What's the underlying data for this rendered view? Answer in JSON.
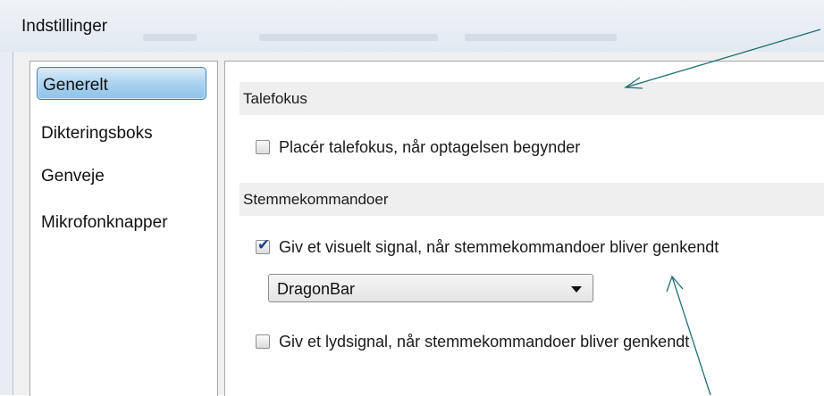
{
  "window": {
    "title": "Indstillinger"
  },
  "sidebar": {
    "items": [
      {
        "label": "Generelt",
        "selected": true
      },
      {
        "label": "Dikteringsboks"
      },
      {
        "label": "Genveje"
      },
      {
        "label": "Mikrofonknapper"
      }
    ]
  },
  "main": {
    "sections": [
      {
        "header": "Talefokus",
        "options": [
          {
            "label": "Placér talefokus, når optagelsen begynder",
            "checked": false
          }
        ]
      },
      {
        "header": "Stemmekommandoer",
        "options": [
          {
            "label": "Giv et visuelt signal, når stemmekommandoer bliver genkendt",
            "checked": true
          },
          {
            "label": "Giv et lydsignal, når stemmekommandoer bliver genkendt",
            "checked": false
          }
        ],
        "dropdown": {
          "selected": "DragonBar"
        }
      }
    ]
  },
  "colors": {
    "selection": "#a7d0ee",
    "selection_border": "#3c7fb1",
    "annotation_arrow": "#1f6f74",
    "checkmark": "#1b3d8f"
  }
}
